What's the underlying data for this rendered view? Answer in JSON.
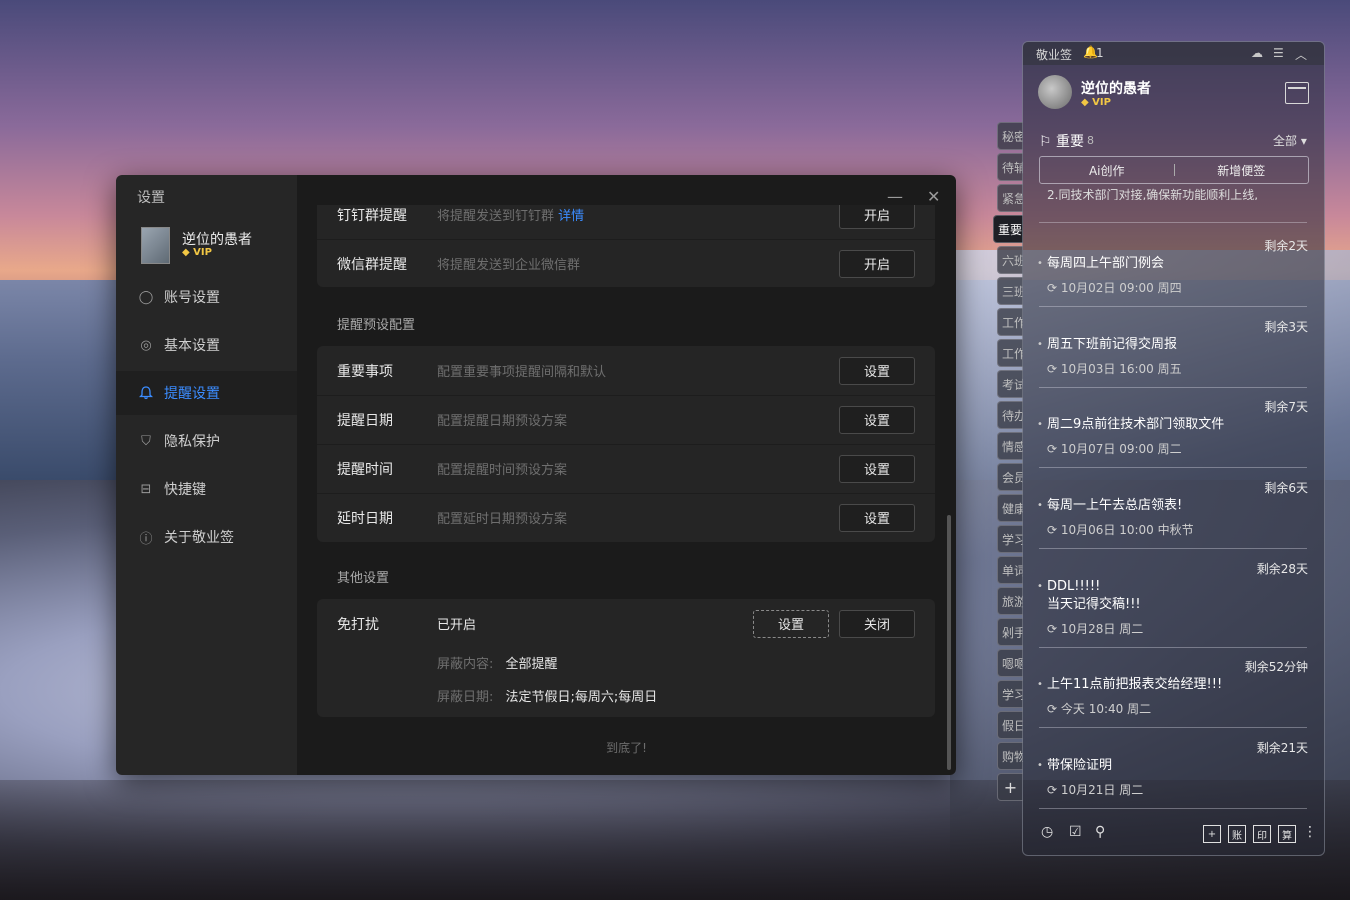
{
  "settings": {
    "window_title": "设置",
    "user": {
      "name": "逆位的愚者",
      "vip": "VIP"
    },
    "nav": [
      {
        "label": "账号设置",
        "icon": "user-icon",
        "glyph": "◯"
      },
      {
        "label": "基本设置",
        "icon": "settings-icon",
        "glyph": "◎"
      },
      {
        "label": "提醒设置",
        "icon": "bell-icon",
        "glyph": "🔔",
        "active": true
      },
      {
        "label": "隐私保护",
        "icon": "shield-icon",
        "glyph": "⛉"
      },
      {
        "label": "快捷键",
        "icon": "keyboard-icon",
        "glyph": "⊟"
      },
      {
        "label": "关于敬业签",
        "icon": "info-icon",
        "glyph": "ⓘ"
      }
    ],
    "controls": {
      "minimize": "—",
      "close": "✕"
    },
    "top_rows": [
      {
        "label": "钉钉群提醒",
        "desc": "将提醒发送到钉钉群",
        "link": "详情",
        "button": "开启"
      },
      {
        "label": "微信群提醒",
        "desc": "将提醒发送到企业微信群",
        "button": "开启"
      }
    ],
    "preset_title": "提醒预设配置",
    "preset_rows": [
      {
        "label": "重要事项",
        "desc": "配置重要事项提醒间隔和默认",
        "button": "设置"
      },
      {
        "label": "提醒日期",
        "desc": "配置提醒日期预设方案",
        "button": "设置"
      },
      {
        "label": "提醒时间",
        "desc": "配置提醒时间预设方案",
        "button": "设置"
      },
      {
        "label": "延时日期",
        "desc": "配置延时日期预设方案",
        "button": "设置"
      }
    ],
    "other_title": "其他设置",
    "dnd": {
      "label": "免打扰",
      "status": "已开启",
      "btn_set": "设置",
      "btn_close": "关闭",
      "shield_label": "屏蔽内容:",
      "shield_value": "全部提醒",
      "dates_label": "屏蔽日期:",
      "dates_value": "法定节假日;每周六;每周日"
    },
    "bottom_tip": "到底了!"
  },
  "note": {
    "app_name": "敬业签",
    "badge_count": "1",
    "user": {
      "name": "逆位的愚者",
      "vip": "VIP"
    },
    "category": "重要",
    "category_count": "8",
    "filter": "全部",
    "actions": [
      "Ai创作",
      "新增便签"
    ],
    "cut_text": "2.同技术部门对接,确保新功能顺利上线,",
    "items": [
      {
        "remain": "剩余2天",
        "title": "每周四上午部门例会",
        "time": "10月02日 09:00 周四"
      },
      {
        "remain": "剩余3天",
        "title": "周五下班前记得交周报",
        "time": "10月03日 16:00 周五"
      },
      {
        "remain": "剩余7天",
        "title": "周二9点前往技术部门领取文件",
        "time": "10月07日 09:00 周二"
      },
      {
        "remain": "剩余6天",
        "title": "每周一上午去总店领表!",
        "time": "10月06日 10:00 中秋节"
      },
      {
        "remain": "剩余28天",
        "title": "DDL!!!!!\n当天记得交稿!!!",
        "time": "10月28日 周二"
      },
      {
        "remain": "剩余52分钟",
        "title": "上午11点前把报表交给经理!!!",
        "time": "今天 10:40 周二"
      },
      {
        "remain": "剩余21天",
        "title": "带保险证明",
        "time": "10月21日 周二"
      }
    ],
    "bottom_boxes": [
      "+",
      "账",
      "印",
      "算"
    ]
  },
  "side_tabs": [
    "秘密",
    "待辅",
    "紧急",
    "重要",
    "六班",
    "三班",
    "工作",
    "工作",
    "考试",
    "待办",
    "情感",
    "会员",
    "健康",
    "学习",
    "单词",
    "旅游",
    "剁手",
    "嗯嗯",
    "学习",
    "假日",
    "购物"
  ]
}
